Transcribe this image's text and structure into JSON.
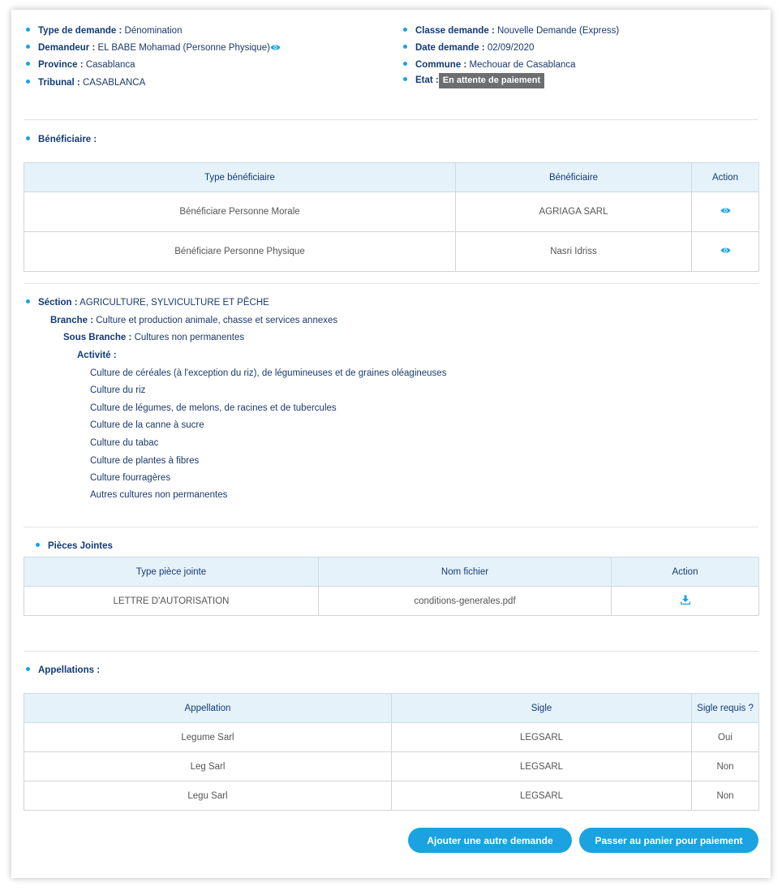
{
  "header": {
    "type_demande_label": "Type de demande :",
    "type_demande_value": "Dénomination",
    "demandeur_label": "Demandeur :",
    "demandeur_value": "EL BABE Mohamad (Personne Physique)",
    "province_label": "Province :",
    "province_value": "Casablanca",
    "tribunal_label": "Tribunal :",
    "tribunal_value": "CASABLANCA",
    "classe_label": "Classe demande :",
    "classe_value": "Nouvelle Demande (Express)",
    "date_label": "Date demande :",
    "date_value": "02/09/2020",
    "commune_label": "Commune :",
    "commune_value": "Mechouar de Casablanca",
    "etat_label": "Etat :",
    "etat_value": "En attente de paiement"
  },
  "beneficiaires": {
    "title": "Bénéficiaire :",
    "headers": [
      "Type bénéficiaire",
      "Bénéficiaire",
      "Action"
    ],
    "rows": [
      {
        "type": "Bénéficiare Personne Morale",
        "name": "AGRIAGA SARL",
        "action_icon": "eye-icon"
      },
      {
        "type": "Bénéficiare Personne Physique",
        "name": "Nasri Idriss",
        "action_icon": "eye-icon"
      }
    ]
  },
  "activite": {
    "section_label": "Séction :",
    "section_value": "AGRICULTURE, SYLVICULTURE ET PÊCHE",
    "branche_label": "Branche :",
    "branche_value": "Culture et production animale, chasse et services annexes",
    "sous_branche_label": "Sous Branche :",
    "sous_branche_value": "Cultures non permanentes",
    "activite_label": "Activité :",
    "items": [
      "Culture de céréales (à l'exception du riz), de légumineuses et de graines oléagineuses",
      "Culture du riz",
      "Culture de légumes, de melons, de racines et de tubercules",
      "Culture de la canne à sucre",
      "Culture du tabac",
      "Culture de plantes à fibres",
      "Culture fourragères",
      "Autres cultures non permanentes"
    ]
  },
  "pieces_jointes": {
    "title": "Pièces Jointes",
    "headers": [
      "Type pièce jointe",
      "Nom fichier",
      "Action"
    ],
    "rows": [
      {
        "type": "LETTRE D'AUTORISATION",
        "file": "conditions-generales.pdf",
        "action_icon": "download-icon"
      }
    ]
  },
  "appellations": {
    "title": "Appellations :",
    "headers": [
      "Appellation",
      "Sigle",
      "Sigle requis ?"
    ],
    "rows": [
      {
        "appellation": "Legume Sarl",
        "sigle": "LEGSARL",
        "requis": "Oui"
      },
      {
        "appellation": "Leg Sarl",
        "sigle": "LEGSARL",
        "requis": "Non"
      },
      {
        "appellation": "Legu Sarl",
        "sigle": "LEGSARL",
        "requis": "Non"
      }
    ]
  },
  "actions": {
    "add_label": "Ajouter une autre demande",
    "pay_label": "Passer au panier pour paiement"
  },
  "colors": {
    "accent": "#1aa3e0",
    "text_dark": "#123a77",
    "badge": "#6d6e70",
    "table_header_bg": "#e6f2fa"
  }
}
